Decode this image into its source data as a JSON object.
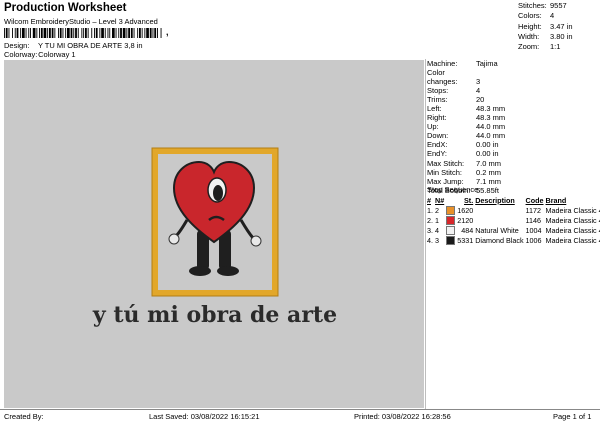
{
  "header": {
    "title": "Production Worksheet",
    "subtitle": "Wilcom EmbroideryStudio – Level 3 Advanced",
    "barcode_suffix": ",",
    "design_label": "Design:",
    "design_value": "Y TU MI OBRA DE ARTE 3,8 in",
    "colorway_label": "Colorway:",
    "colorway_value": "Colorway 1"
  },
  "stats": [
    {
      "label": "Stitches:",
      "value": "9557"
    },
    {
      "label": "Colors:",
      "value": "4"
    },
    {
      "label": "Height:",
      "value": "3.47 in"
    },
    {
      "label": "Width:",
      "value": "3.80 in"
    },
    {
      "label": "Zoom:",
      "value": "1:1"
    }
  ],
  "machine_info": [
    {
      "label": "Machine:",
      "value": "Tajima"
    },
    {
      "label": "Color changes:",
      "value": "3"
    },
    {
      "label": "Stops:",
      "value": "4"
    },
    {
      "label": "Trims:",
      "value": "20"
    },
    {
      "label": "Left:",
      "value": "48.3 mm"
    },
    {
      "label": "Right:",
      "value": "48.3 mm"
    },
    {
      "label": "Up:",
      "value": "44.0 mm"
    },
    {
      "label": "Down:",
      "value": "44.0 mm"
    },
    {
      "label": "EndX:",
      "value": "0.00 in"
    },
    {
      "label": "EndY:",
      "value": "0.00 in"
    },
    {
      "label": "Max Stitch:",
      "value": "7.0 mm"
    },
    {
      "label": "Min Stitch:",
      "value": "0.2 mm"
    },
    {
      "label": "Max Jump:",
      "value": "7.1 mm"
    },
    {
      "label": "Total Bobbin:",
      "value": "55.85ft"
    }
  ],
  "stop_sequence": {
    "title": "Stop Sequence:",
    "headers": [
      "#",
      "N#",
      "St.",
      "Description",
      "Code",
      "Brand"
    ],
    "rows": [
      {
        "num": "1.",
        "n": "2",
        "color": "#e8912a",
        "st": "1620",
        "desc": "",
        "code": "1172",
        "brand": "Madeira Classic 40"
      },
      {
        "num": "2.",
        "n": "1",
        "color": "#d8262a",
        "st": "2120",
        "desc": "",
        "code": "1146",
        "brand": "Madeira Classic 40"
      },
      {
        "num": "3.",
        "n": "4",
        "color": "#f2f2f2",
        "st": "484",
        "desc": "Natural White",
        "code": "1004",
        "brand": "Madeira Classic 40"
      },
      {
        "num": "4.",
        "n": "3",
        "color": "#1a1a1a",
        "st": "5331",
        "desc": "Diamond Black",
        "code": "1006",
        "brand": "Madeira Classic 40"
      }
    ]
  },
  "design_text": "y tú mi obra de arte",
  "footer": {
    "created_by": "Created By:",
    "last_saved": "Last Saved: 03/08/2022 16:15:21",
    "printed": "Printed: 03/08/2022 16:28:56",
    "page": "Page 1 of 1"
  },
  "colors": {
    "frame_gold": "#e2a72a",
    "frame_inner": "#c9c9c9",
    "heart_red": "#c9262c",
    "body_black": "#1f1f1f",
    "canvas_bg": "#c9c9c9"
  }
}
